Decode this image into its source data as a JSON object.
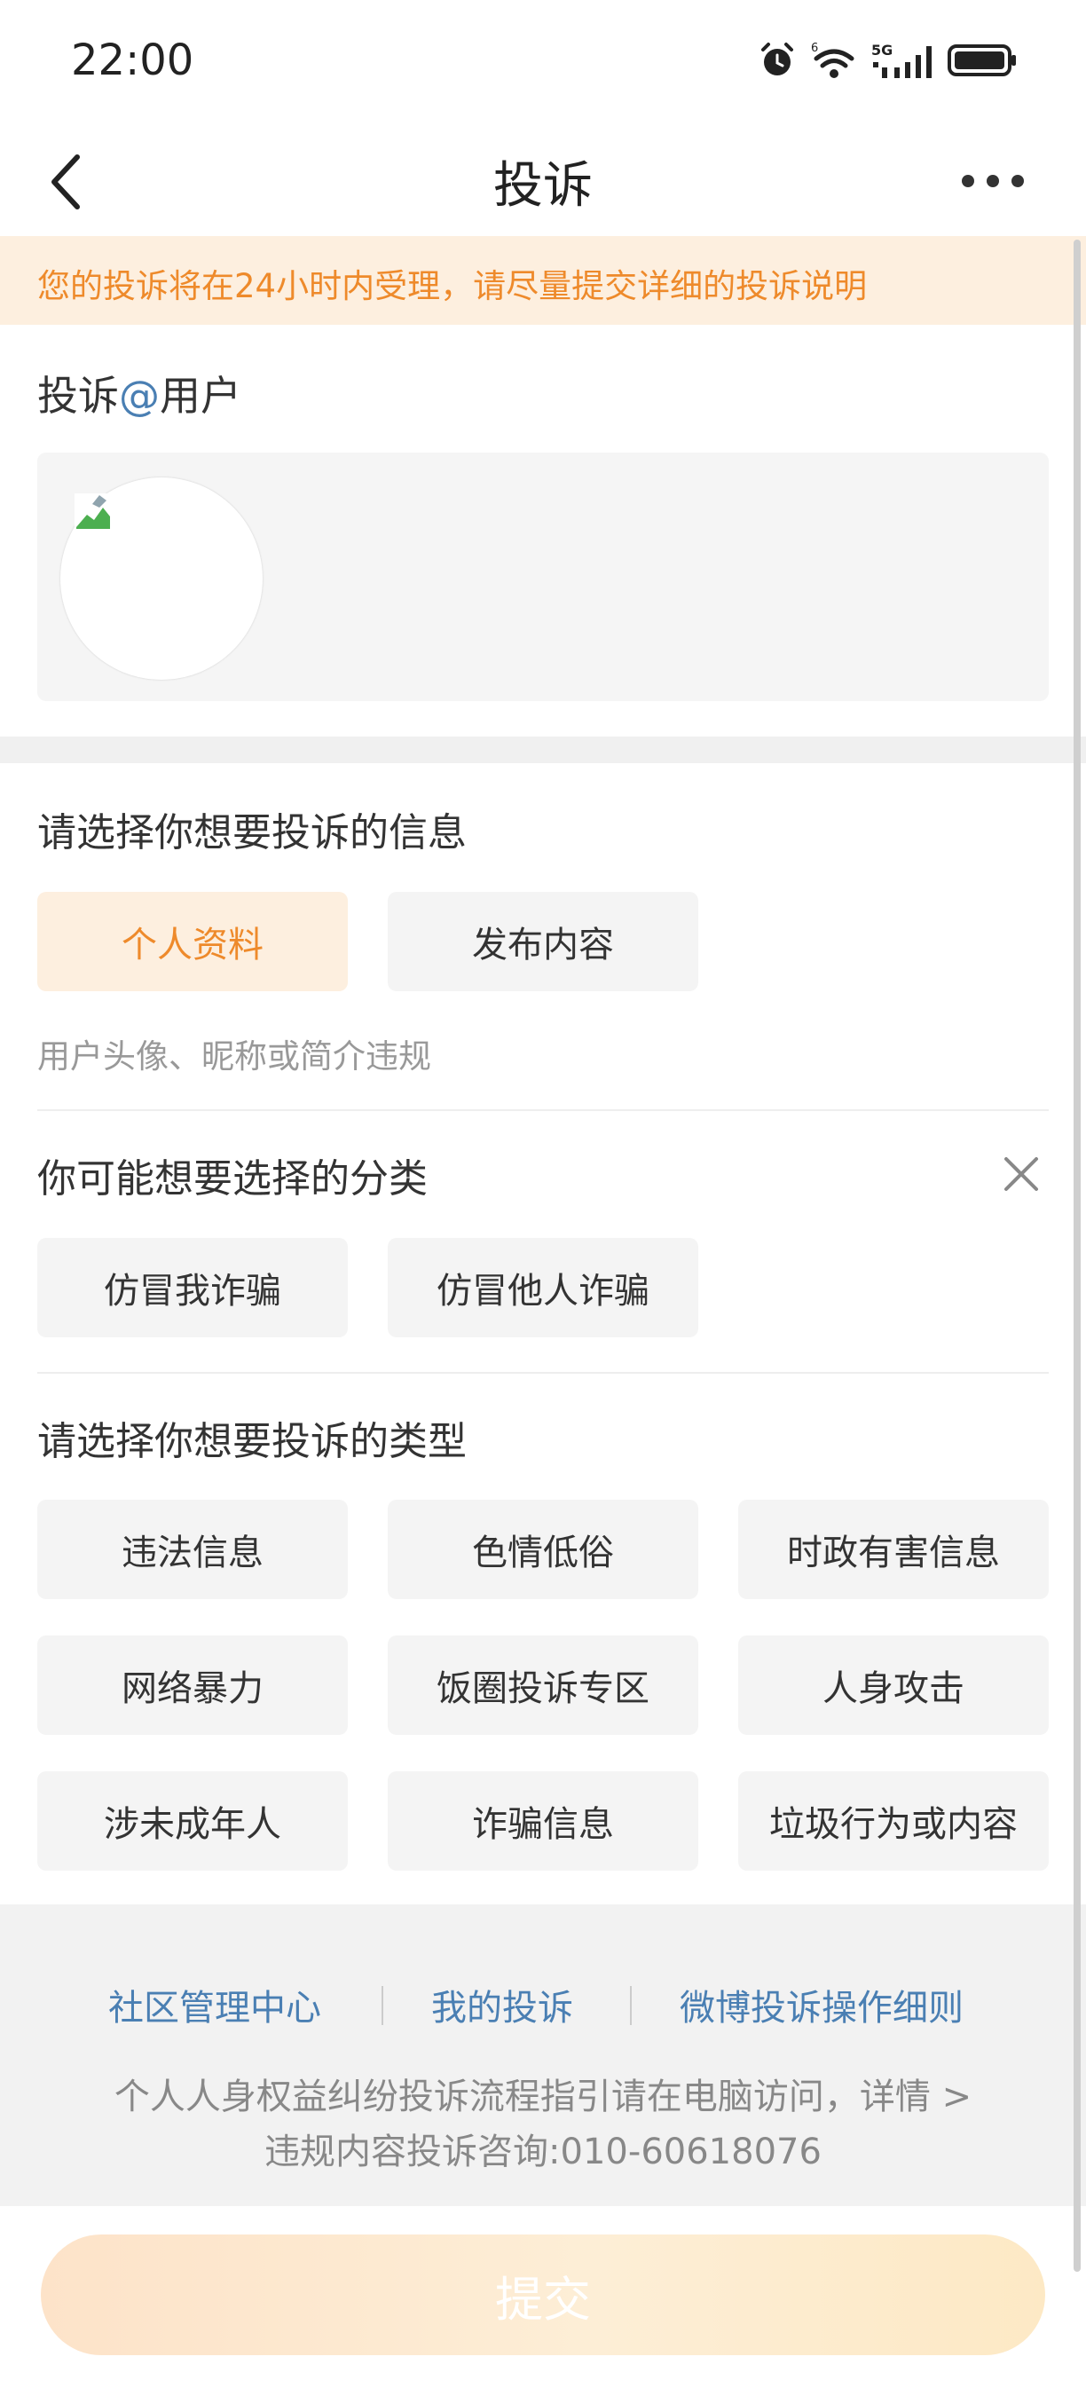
{
  "status_bar": {
    "time": "22:00",
    "icons": [
      "alarm-icon",
      "wifi-icon",
      "5g-signal-icon",
      "battery-icon"
    ]
  },
  "nav": {
    "title": "投诉",
    "back_icon": "back-arrow-icon",
    "more_icon": "more-dots-icon"
  },
  "notice": {
    "text": "您的投诉将在24小时内受理，请尽量提交详细的投诉说明"
  },
  "report_user": {
    "label_prefix": "投诉",
    "label_at": "@",
    "label_suffix": "用户"
  },
  "info_section": {
    "title": "请选择你想要投诉的信息",
    "options": [
      {
        "label": "个人资料",
        "selected": true
      },
      {
        "label": "发布内容",
        "selected": false
      }
    ],
    "hint": "用户头像、昵称或简介违规"
  },
  "suggest_section": {
    "title": "你可能想要选择的分类",
    "options": [
      "仿冒我诈骗",
      "仿冒他人诈骗"
    ]
  },
  "type_section": {
    "title": "请选择你想要投诉的类型",
    "options": [
      "违法信息",
      "色情低俗",
      "时政有害信息",
      "网络暴力",
      "饭圈投诉专区",
      "人身攻击",
      "涉未成年人",
      "诈骗信息",
      "垃圾行为或内容"
    ]
  },
  "footer": {
    "links": [
      "社区管理中心",
      "我的投诉",
      "微博投诉操作细则"
    ],
    "info_text": "个人人身权益纠纷投诉流程指引请在电脑访问，详情",
    "info_chevron": ">",
    "phone_text": "违规内容投诉咨询:010-60618076"
  },
  "submit": {
    "label": "提交"
  },
  "colors": {
    "accent": "#ee8a2b",
    "accent_bg": "#fdefdf",
    "link": "#4a7fb3",
    "chip_bg": "#f4f4f4",
    "footer_bg": "#f2f2f2"
  }
}
